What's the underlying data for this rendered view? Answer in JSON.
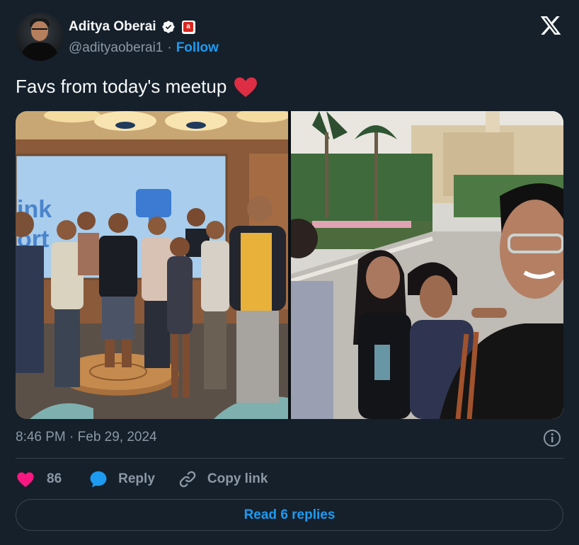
{
  "author": {
    "name": "Aditya Oberai",
    "handle": "@adityaoberai1",
    "follow_label": "Follow",
    "verified_icon": "verified-badge-icon",
    "affiliation_icon": "affiliate-badge-icon"
  },
  "tweet": {
    "text": "Favs from today's meetup",
    "emoji": "red-heart-icon"
  },
  "media": {
    "count": 2,
    "items": [
      "group-photo-meetup",
      "selfie-outdoors"
    ]
  },
  "meta": {
    "timestamp": "8:46 PM · Feb 29, 2024"
  },
  "actions": {
    "like_count": "86",
    "reply_label": "Reply",
    "copy_link_label": "Copy link"
  },
  "footer": {
    "read_replies_label": "Read 6 replies"
  },
  "colors": {
    "background": "#15202b",
    "accent": "#1d9bf0",
    "like": "#f91880",
    "muted": "#8b98a5"
  }
}
